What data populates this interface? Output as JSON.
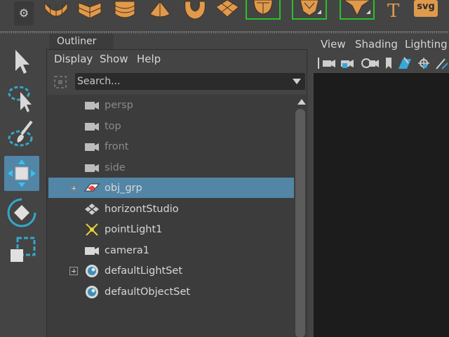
{
  "shelf": {
    "icons": [
      "shelf-gear-icon",
      "sphere-icon",
      "cube-icon",
      "cylinder-icon",
      "cone-icon",
      "torus-icon",
      "plane-icon",
      "soccer-ball-icon",
      "platonic-icon",
      "pyramid-icon",
      "text-icon",
      "svg-icon"
    ],
    "gear_glyph": "⚙",
    "svg_label": "svg",
    "text_glyph": "T",
    "accent_color": "#e09a4b",
    "bracket_color": "#27c227"
  },
  "toolbox": {
    "tools": [
      "select-tool-icon",
      "lasso-tool-icon",
      "paint-select-tool-icon",
      "move-tool-icon",
      "rotate-tool-icon",
      "scale-tool-icon"
    ],
    "active": "move-tool-icon"
  },
  "outliner": {
    "tab_label": "Outliner",
    "menu": [
      "Display",
      "Show",
      "Help"
    ],
    "search_placeholder": "Search...",
    "items": [
      {
        "label": "persp",
        "icon": "camera-icon",
        "dim": true,
        "expandable": false,
        "selected": false
      },
      {
        "label": "top",
        "icon": "camera-icon",
        "dim": true,
        "expandable": false,
        "selected": false
      },
      {
        "label": "front",
        "icon": "camera-icon",
        "dim": true,
        "expandable": false,
        "selected": false
      },
      {
        "label": "side",
        "icon": "camera-icon",
        "dim": true,
        "expandable": false,
        "selected": false
      },
      {
        "label": "obj_grp",
        "icon": "group-icon",
        "dim": false,
        "expandable": true,
        "selected": true
      },
      {
        "label": "horizontStudio",
        "icon": "mesh-icon",
        "dim": false,
        "expandable": false,
        "selected": false
      },
      {
        "label": "pointLight1",
        "icon": "point-light-icon",
        "dim": false,
        "expandable": false,
        "selected": false
      },
      {
        "label": "camera1",
        "icon": "camera-icon",
        "dim": false,
        "expandable": false,
        "selected": false
      },
      {
        "label": "defaultLightSet",
        "icon": "set-icon",
        "dim": false,
        "expandable": true,
        "selected": false
      },
      {
        "label": "defaultObjectSet",
        "icon": "set-icon",
        "dim": false,
        "expandable": false,
        "selected": false
      }
    ],
    "selection_color": "#5285a6"
  },
  "viewport": {
    "menu": [
      "View",
      "Shading",
      "Lighting"
    ],
    "toolbar_icons": [
      "camera-select-icon",
      "camera-lock-icon",
      "camera-attributes-icon",
      "bookmark-icon",
      "image-plane-icon",
      "grease-pencil-icon",
      "grid-icon"
    ]
  }
}
